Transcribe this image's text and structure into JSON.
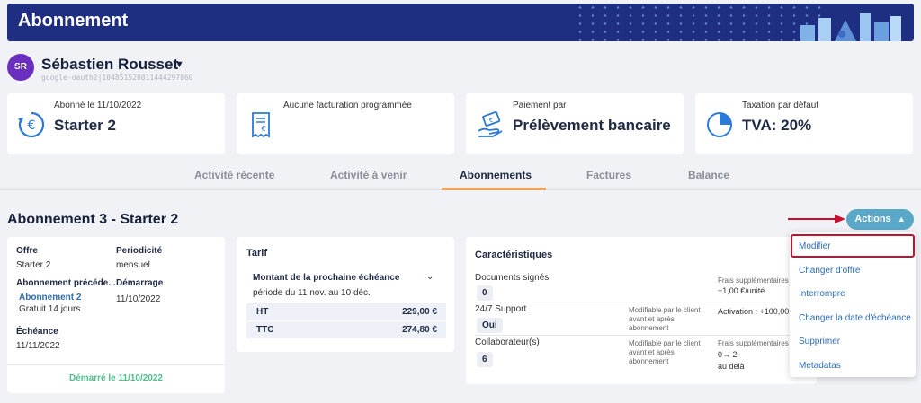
{
  "header": {
    "title": "Abonnement"
  },
  "user": {
    "initials": "SR",
    "name": "Sébastien Rousset",
    "id": "google-oauth2|104851528811444297860"
  },
  "stats": [
    {
      "label": "Abonné le 11/10/2022",
      "value": "Starter 2",
      "icon": "euro-cycle-icon"
    },
    {
      "label": "Aucune facturation programmée",
      "value": "",
      "icon": "invoice-icon"
    },
    {
      "label": "Paiement par",
      "value": "Prélèvement bancaire",
      "icon": "bank-payment-icon"
    },
    {
      "label": "Taxation par défaut",
      "value": "TVA: 20%",
      "icon": "pie-chart-icon"
    }
  ],
  "tabs": [
    {
      "label": "Activité récente",
      "active": false
    },
    {
      "label": "Activité à venir",
      "active": false
    },
    {
      "label": "Abonnements",
      "active": true
    },
    {
      "label": "Factures",
      "active": false
    },
    {
      "label": "Balance",
      "active": false
    }
  ],
  "section_title": "Abonnement 3 - Starter 2",
  "actions_label": "Actions",
  "overview": {
    "offre_label": "Offre",
    "offre_value": "Starter 2",
    "periodicite_label": "Periodicité",
    "periodicite_value": "mensuel",
    "prev_label": "Abonnement précéde...",
    "prev_link": "Abonnement 2",
    "prev_sub": "Gratuit 14 jours",
    "demarrage_label": "Démarrage",
    "demarrage_value": "11/10/2022",
    "echeance_label": "Échéance",
    "echeance_value": "11/11/2022",
    "started_text": "Démarré le 11/10/2022"
  },
  "tarif": {
    "title": "Tarif",
    "next_label": "Montant de la prochaine échéance",
    "period": "période du 11 nov. au 10 déc.",
    "rows": [
      {
        "k": "HT",
        "v": "229,00 €"
      },
      {
        "k": "TTC",
        "v": "274,80 €"
      }
    ]
  },
  "caract": {
    "title": "Caractéristiques",
    "docs_label": "Documents signés",
    "docs_value": "0",
    "docs_extra_1": "Frais supplémentaires",
    "docs_extra_2": "+1,00 €/unité",
    "support_label": "24/7 Support",
    "support_value": "Oui",
    "support_mod_1": "Modifiable par le client",
    "support_mod_2": "avant et après",
    "support_mod_3": "abonnement",
    "support_extra": "Activation : +100,00",
    "collab_label": "Collaborateur(s)",
    "collab_value": "6",
    "collab_mod_1": "Modifiable par le client",
    "collab_mod_2": "avant et après",
    "collab_mod_3": "abonnement",
    "collab_extra_1": "Frais supplémentaires",
    "collab_extra_2": "0→ 2",
    "collab_extra_3": "au delà"
  },
  "menu": {
    "items": [
      "Modifier",
      "Changer d'offre",
      "Interrompre",
      "Changer la date d'échéance",
      "Supprimer",
      "Metadatas"
    ]
  },
  "colors": {
    "brand": "#1e2f82",
    "accent": "#5aa8c7",
    "highlight": "#c8102e",
    "success": "#4fbf8b"
  }
}
